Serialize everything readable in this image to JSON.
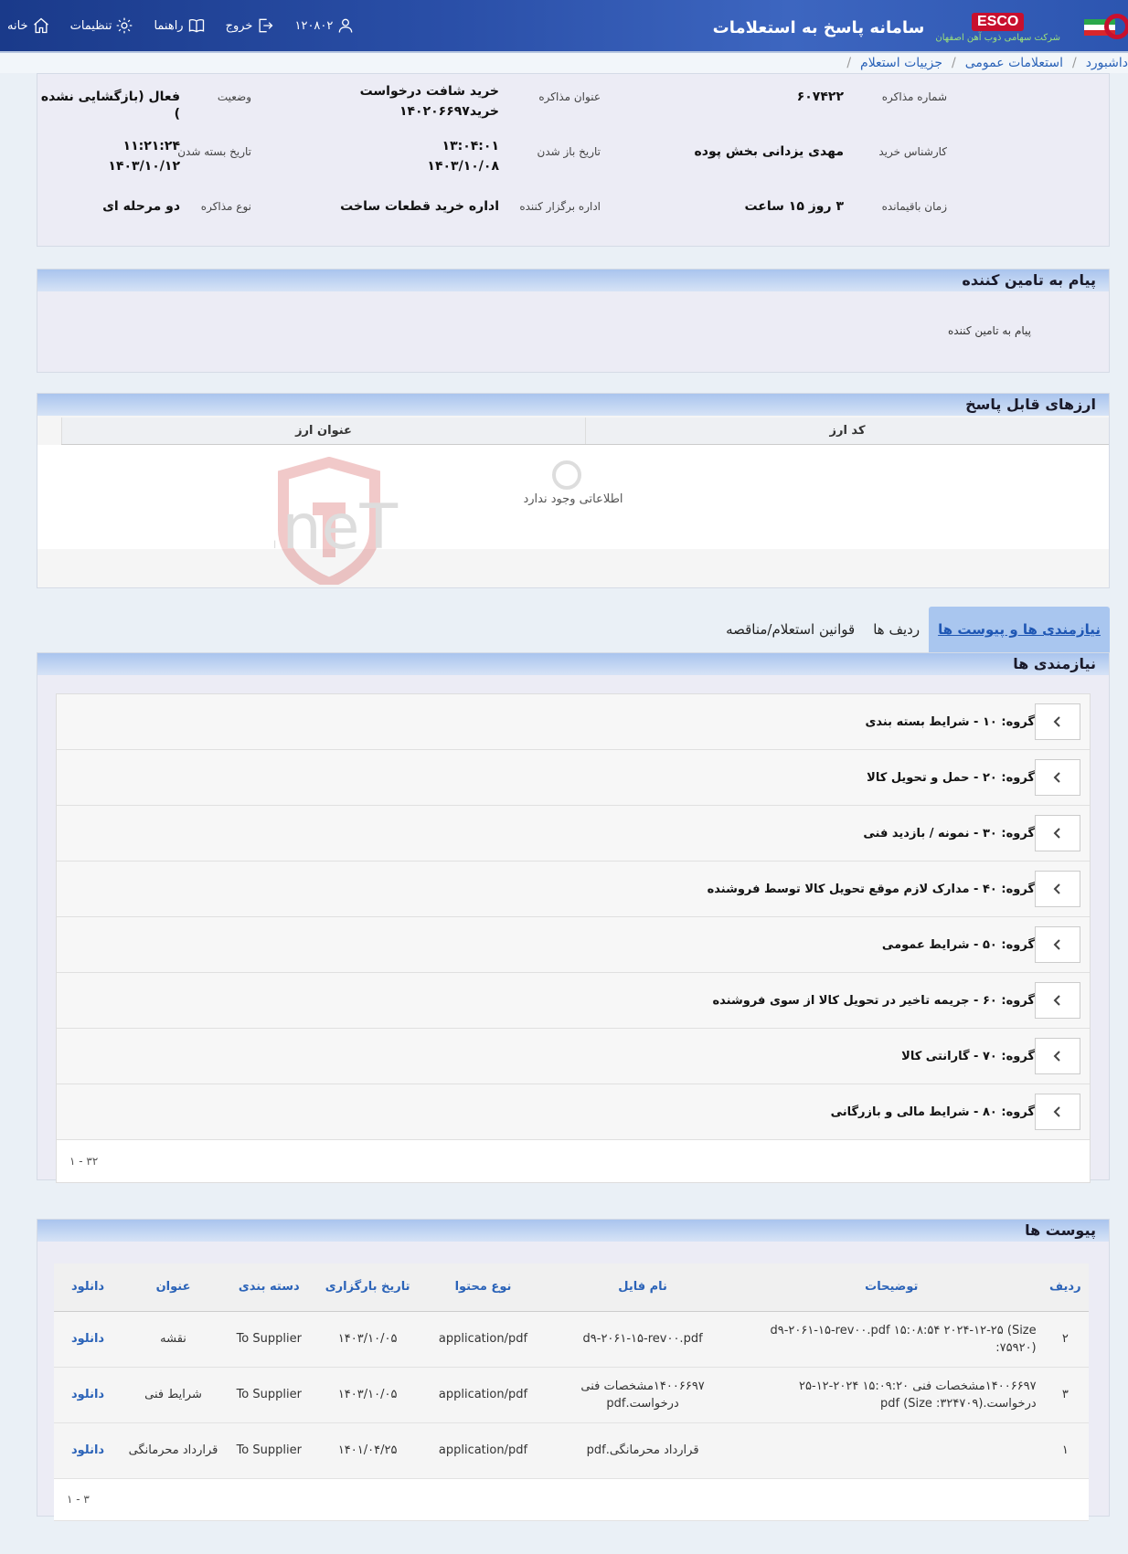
{
  "header": {
    "title": "سامانه پاسخ به استعلامات",
    "brand": "ESCO",
    "brand_sub": "شرکت سهامی ذوب آهن اصفهان",
    "nav": {
      "home": "خانه",
      "settings": "تنظیمات",
      "guide": "راهنما",
      "logout": "خروج",
      "user_id": "۱۲۰۸۰۲"
    }
  },
  "breadcrumb": [
    "داشبورد",
    "استعلامات عمومی",
    "جزییات استعلام"
  ],
  "info": {
    "labels": {
      "number": "شماره مذاکره",
      "title": "عنوان مذاکره",
      "status": "وضعیت",
      "expert": "کارشناس خرید",
      "open_date": "تاریخ باز شدن",
      "close_date": "تاریخ بسته شدن",
      "remaining": "زمان باقیمانده",
      "office": "اداره برگزار کننده",
      "type": "نوع مذاکره"
    },
    "values": {
      "number": "۶۰۷۴۲۲",
      "title_1": "خرید شافت درخواست",
      "title_2": "خرید۱۴۰۲۰۶۶۹۷",
      "status": "فعال (بازگشایی نشده )",
      "expert": "مهدی یزدانی بخش پوده",
      "open_time": "۱۳:۰۴:۰۱",
      "open_date": "۱۴۰۳/۱۰/۰۸",
      "close_time": "۱۱:۲۱:۲۴",
      "close_date": "۱۴۰۳/۱۰/۱۲",
      "remaining": "۳ روز ۱۵ ساعت",
      "office": "اداره خرید قطعات ساخت",
      "type": "دو مرحله ای"
    }
  },
  "message": {
    "heading": "پیام به تامین کننده",
    "label": "پیام به تامین کننده"
  },
  "currencies": {
    "heading": "ارزهای قابل پاسخ",
    "columns": [
      "کد ارز",
      "عنوان ارز"
    ],
    "empty": "اطلاعاتی وجود ندارد"
  },
  "watermark": "AriaTender.neT",
  "tabs": [
    "نیازمندی ها و پیوست ها",
    "ردیف ها",
    "قوانین استعلام/مناقصه"
  ],
  "needs": {
    "heading": "نیازمندی ها",
    "groups": [
      "گروه: ۱۰ - شرایط بسته بندی",
      "گروه: ۲۰ - حمل و تحویل کالا",
      "گروه: ۳۰ - نمونه / بازدید فنی",
      "گروه: ۴۰ - مدارک لازم موقع تحویل کالا توسط فروشنده",
      "گروه: ۵۰ - شرایط عمومی",
      "گروه: ۶۰ - جریمه تاخیر در تحویل کالا از سوی فروشنده",
      "گروه: ۷۰ - گارانتی کالا",
      "گروه: ۸۰ - شرایط مالی و بازرگانی"
    ],
    "pager": "۱ - ۳۲"
  },
  "attachments": {
    "heading": "پیوست ها",
    "columns": [
      "ردیف",
      "توضیحات",
      "نام فایل",
      "نوع محتوا",
      "تاریخ بارگزاری",
      "دسته بندی",
      "عنوان",
      "دانلود"
    ],
    "rows": [
      [
        "۲",
        "d۹-۲۰۶۱-۱۵-rev۰۰.pdf ۱۵:۰۸:۵۴ ۲۰۲۴-۱۲-۲۵ (Size :۷۵۹۲۰)",
        "d۹-۲۰۶۱-۱۵-rev۰۰.pdf",
        "application/pdf",
        "۱۴۰۳/۱۰/۰۵",
        "To Supplier",
        "نقشه",
        "دانلود"
      ],
      [
        "۳",
        "۱۴۰۰۶۶۹۷مشخصات فنی ۱۵:۰۹:۲۰ ۲۰۲۴-۱۲-۲۵ درخواست.(pdf (Size :۳۲۴۷۰۹",
        "۱۴۰۰۶۶۹۷مشخصات فنی درخواست.pdf",
        "application/pdf",
        "۱۴۰۳/۱۰/۰۵",
        "To Supplier",
        "شرایط فنی",
        "دانلود"
      ],
      [
        "۱",
        "",
        "قرارداد محرمانگی.pdf",
        "application/pdf",
        "۱۴۰۱/۰۴/۲۵",
        "To Supplier",
        "قرارداد محرمانگی",
        "دانلود"
      ]
    ],
    "pager": "۱ - ۳"
  }
}
